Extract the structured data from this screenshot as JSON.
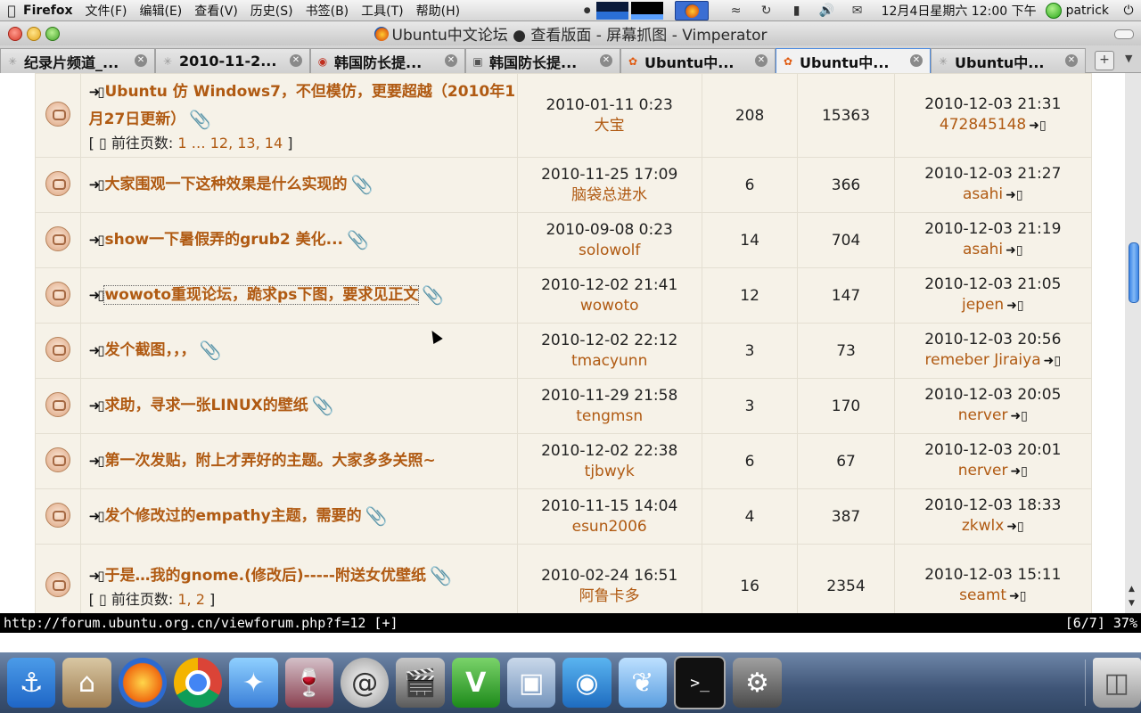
{
  "menubar": {
    "app_name": "Firefox",
    "menus": [
      "文件(F)",
      "编辑(E)",
      "查看(V)",
      "历史(S)",
      "书签(B)",
      "工具(T)",
      "帮助(H)"
    ],
    "clock": "12月4日星期六 12:00 下午",
    "user": "patrick"
  },
  "window": {
    "title": "Ubuntu中文论坛 ● 查看版面 - 屏幕抓图 - Vimperator"
  },
  "tabs": [
    {
      "label": "纪录片频道_..."
    },
    {
      "label": "2010-11-2..."
    },
    {
      "label": "韩国防长提..."
    },
    {
      "label": "韩国防长提..."
    },
    {
      "label": "Ubuntu中..."
    },
    {
      "label": "Ubuntu中...",
      "active": true
    },
    {
      "label": "Ubuntu中..."
    }
  ],
  "topics": [
    {
      "title": "Ubuntu 仿 Windows7，不但模仿，更要超越（2010年1月27日更新）",
      "has_attachment": true,
      "pages_prefix": "[ ",
      "pages_label": "前往页数:",
      "pages": "1 … 12, 13, 14",
      "pages_suffix": " ]",
      "post_date": "2010-01-11 0:23",
      "author": "大宝",
      "replies": "208",
      "views": "15363",
      "last_date": "2010-12-03 21:31",
      "last_user": "472845148"
    },
    {
      "title": "大家围观一下这种效果是什么实现的",
      "has_attachment": true,
      "post_date": "2010-11-25 17:09",
      "author": "脑袋总进水",
      "replies": "6",
      "views": "366",
      "last_date": "2010-12-03 21:27",
      "last_user": "asahi"
    },
    {
      "title": "show一下暑假弄的grub2 美化...",
      "has_attachment": true,
      "post_date": "2010-09-08 0:23",
      "author": "solowolf",
      "replies": "14",
      "views": "704",
      "last_date": "2010-12-03 21:19",
      "last_user": "asahi"
    },
    {
      "title": "wowoto重现论坛，跪求ps下图，要求见正文",
      "has_attachment": true,
      "focused": true,
      "post_date": "2010-12-02 21:41",
      "author": "wowoto",
      "replies": "12",
      "views": "147",
      "last_date": "2010-12-03 21:05",
      "last_user": "jepen"
    },
    {
      "title": "发个截图，，，",
      "has_attachment": true,
      "post_date": "2010-12-02 22:12",
      "author": "tmacyunn",
      "replies": "3",
      "views": "73",
      "last_date": "2010-12-03 20:56",
      "last_user": "remeber Jiraiya"
    },
    {
      "title": "求助，寻求一张LINUX的壁纸",
      "has_attachment": true,
      "post_date": "2010-11-29 21:58",
      "author": "tengmsn",
      "replies": "3",
      "views": "170",
      "last_date": "2010-12-03 20:05",
      "last_user": "nerver"
    },
    {
      "title": "第一次发贴，附上才弄好的主题。大家多多关照~",
      "has_attachment": false,
      "post_date": "2010-12-02 22:38",
      "author": "tjbwyk",
      "replies": "6",
      "views": "67",
      "last_date": "2010-12-03 20:01",
      "last_user": "nerver"
    },
    {
      "title": "发个修改过的empathy主题，需要的",
      "has_attachment": true,
      "post_date": "2010-11-15 14:04",
      "author": "esun2006",
      "replies": "4",
      "views": "387",
      "last_date": "2010-12-03 18:33",
      "last_user": "zkwlx"
    },
    {
      "title": "于是…我的gnome.(修改后)-----附送女优壁纸",
      "has_attachment": true,
      "pages_prefix": "[ ",
      "pages_label": "前往页数:",
      "pages": "1, 2",
      "pages_suffix": " ]",
      "post_date": "2010-02-24 16:51",
      "author": "阿鲁卡多",
      "replies": "16",
      "views": "2354",
      "last_date": "2010-12-03 15:11",
      "last_user": "seamt"
    }
  ],
  "statusbar": {
    "url": "http://forum.ubuntu.org.cn/viewforum.php?f=12 [+]",
    "position": "[6/7] 37%"
  },
  "dock": {
    "items": [
      "anchor-icon",
      "home-icon",
      "firefox-icon",
      "chrome-icon",
      "bird-icon",
      "wine-icon",
      "at-sign-icon",
      "film-icon",
      "vim-icon",
      "photo-viewer-icon",
      "camera-icon",
      "feather-icon",
      "terminal-icon",
      "settings-gear-icon",
      "trash-icon"
    ],
    "terminal_glyph": ">_",
    "vim_glyph": "V"
  },
  "colors": {
    "topic_link": "#b05a12",
    "row_background": "#f6f2e8",
    "active_tab_border": "#4d8be0",
    "status_background": "#000000"
  }
}
